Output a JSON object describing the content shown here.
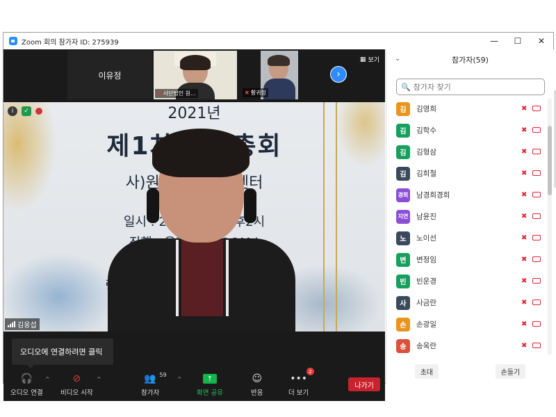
{
  "window": {
    "title": "Zoom 회의 참가자 ID: 275939"
  },
  "strip": {
    "name_tile": "이유정",
    "thumbs": [
      {
        "label": "사단법인 원..."
      },
      {
        "label": "황귀정"
      }
    ],
    "view_label": "보기"
  },
  "slide": {
    "year": "2021년",
    "title": "제1차 정기총회",
    "org": "사)원주지역 지원센터",
    "date": "일시 : 2021. 12. 오후2시",
    "mode": "진행 : 온라인 ( ZOOM )",
    "link": "링"
  },
  "speaker": {
    "name": "김웅섭"
  },
  "tooltip": {
    "text": "오디오에 연결하려면 클릭"
  },
  "toolbar": {
    "audio": "오디오 연결",
    "video": "비디오 시작",
    "participants": "참가자",
    "participants_count": "59",
    "share": "화면 공유",
    "reactions": "반응",
    "more": "더 보기",
    "more_badge": "2",
    "leave": "나가기"
  },
  "panel": {
    "title": "참가자(59)",
    "search_placeholder": "참가자 찾기",
    "invite": "초대",
    "raise_hand": "손들기",
    "participants": [
      {
        "initial": "김",
        "name": "김영희",
        "color": "#e8951f"
      },
      {
        "initial": "김",
        "name": "김학수",
        "color": "#17a05d"
      },
      {
        "initial": "김",
        "name": "김형삼",
        "color": "#17a05d"
      },
      {
        "initial": "김",
        "name": "김희철",
        "color": "#3a4a5c"
      },
      {
        "initial": "경희",
        "name": "남경희경희",
        "color": "#8b4fd6"
      },
      {
        "initial": "지연",
        "name": "남윤진",
        "color": "#8b4fd6"
      },
      {
        "initial": "노",
        "name": "노이선",
        "color": "#3a4a5c"
      },
      {
        "initial": "변",
        "name": "변정임",
        "color": "#17a05d"
      },
      {
        "initial": "빈",
        "name": "빈운경",
        "color": "#17a05d"
      },
      {
        "initial": "사",
        "name": "사금란",
        "color": "#3a4a5c"
      },
      {
        "initial": "손",
        "name": "손광일",
        "color": "#e8951f"
      },
      {
        "initial": "송",
        "name": "송옥란",
        "color": "#d8513a"
      }
    ]
  }
}
